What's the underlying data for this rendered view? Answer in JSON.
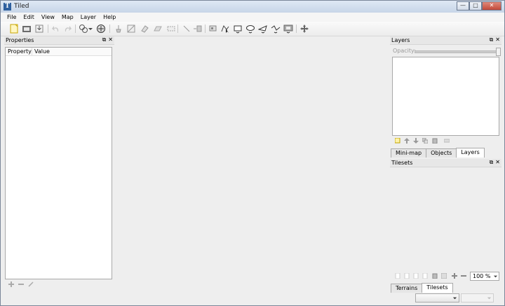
{
  "window": {
    "title": "Tiled",
    "app_icon_letter": "T",
    "minimize": "—",
    "maximize": "□",
    "close": "✕"
  },
  "menu": [
    "File",
    "Edit",
    "View",
    "Map",
    "Layer",
    "Help"
  ],
  "toolbar": {
    "icons": [
      "new-map-icon",
      "open-icon",
      "save-icon",
      "undo-icon",
      "redo-icon",
      "random-mode-icon",
      "stamp-brush-icon",
      "terrain-brush-icon",
      "bucket-fill-icon",
      "eraser-icon",
      "rectangular-select-icon",
      "magic-wand-icon",
      "select-same-tile-icon",
      "insert-tile-icon",
      "edit-polygons-icon",
      "select-objects-icon",
      "insert-rectangle-icon",
      "insert-ellipse-icon",
      "insert-polygon-icon",
      "insert-polyline-icon",
      "insert-image-icon",
      "move-icon"
    ]
  },
  "properties": {
    "title": "Properties",
    "columns": [
      "Property",
      "Value"
    ]
  },
  "layers": {
    "title": "Layers",
    "opacity_label": "Opacity:",
    "tabs": [
      "Mini-map",
      "Objects",
      "Layers"
    ],
    "active_tab": "Layers"
  },
  "tilesets": {
    "title": "Tilesets",
    "zoom": "100 %",
    "tabs": [
      "Terrains",
      "Tilesets"
    ],
    "active_tab": "Tilesets"
  },
  "dock_buttons": {
    "float": "⧉",
    "close": "✕"
  }
}
